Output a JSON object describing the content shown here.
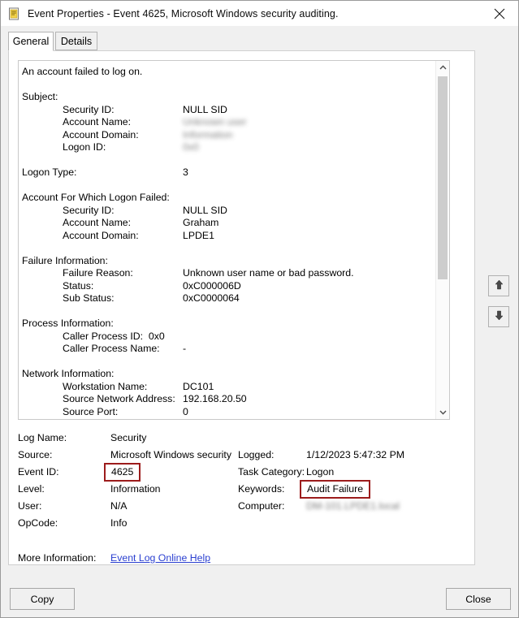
{
  "window": {
    "title": "Event Properties - Event 4625, Microsoft Windows security auditing.",
    "icon": "event-log-icon",
    "close_icon": "close-icon"
  },
  "tabs": [
    {
      "label": "General",
      "active": true
    },
    {
      "label": "Details",
      "active": false
    }
  ],
  "description": {
    "headline": "An account failed to log on.",
    "lines": [
      {
        "indent": 0,
        "label": "Subject:",
        "value": ""
      },
      {
        "indent": 1,
        "label": "Security ID:",
        "value": "NULL SID"
      },
      {
        "indent": 1,
        "label": "Account Name:",
        "value": "Unknown user",
        "blurred": true
      },
      {
        "indent": 1,
        "label": "Account Domain:",
        "value": "Information",
        "blurred": true
      },
      {
        "indent": 1,
        "label": "Logon ID:",
        "value": "0x0",
        "blurred": true
      },
      {
        "indent": 0,
        "label": "",
        "value": ""
      },
      {
        "indent": 0,
        "label": "Logon Type:",
        "value": "3"
      },
      {
        "indent": 0,
        "label": "",
        "value": ""
      },
      {
        "indent": 0,
        "label": "Account For Which Logon Failed:",
        "value": ""
      },
      {
        "indent": 1,
        "label": "Security ID:",
        "value": "NULL SID"
      },
      {
        "indent": 1,
        "label": "Account Name:",
        "value": "Graham"
      },
      {
        "indent": 1,
        "label": "Account Domain:",
        "value": "LPDE1"
      },
      {
        "indent": 0,
        "label": "",
        "value": ""
      },
      {
        "indent": 0,
        "label": "Failure Information:",
        "value": ""
      },
      {
        "indent": 1,
        "label": "Failure Reason:",
        "value": "Unknown user name or bad password."
      },
      {
        "indent": 1,
        "label": "Status:",
        "value": "0xC000006D"
      },
      {
        "indent": 1,
        "label": "Sub Status:",
        "value": "0xC0000064"
      },
      {
        "indent": 0,
        "label": "",
        "value": ""
      },
      {
        "indent": 0,
        "label": "Process Information:",
        "value": ""
      },
      {
        "indent": 1,
        "label": "Caller Process ID:  0x0",
        "value": "",
        "inline": true
      },
      {
        "indent": 1,
        "label": "Caller Process Name:",
        "value": "-"
      },
      {
        "indent": 0,
        "label": "",
        "value": ""
      },
      {
        "indent": 0,
        "label": "Network Information:",
        "value": ""
      },
      {
        "indent": 1,
        "label": "Workstation Name:",
        "value": "DC101"
      },
      {
        "indent": 1,
        "label": "Source Network Address:",
        "value": "192.168.20.50"
      },
      {
        "indent": 1,
        "label": "Source Port:",
        "value": "0"
      }
    ]
  },
  "scrollbar": {
    "up_icon": "chevron-up-icon",
    "down_icon": "chevron-down-icon"
  },
  "metadata": {
    "rows": [
      {
        "label": "Log Name:",
        "value": "Security",
        "label2": "",
        "value2": ""
      },
      {
        "label": "Source:",
        "value": "Microsoft Windows security",
        "label2": "Logged:",
        "value2": "1/12/2023 5:47:32 PM"
      },
      {
        "label": "Event ID:",
        "value": "4625",
        "label2": "Task Category:",
        "value2": "Logon",
        "highlight": true
      },
      {
        "label": "Level:",
        "value": "Information",
        "label2": "Keywords:",
        "value2": "Audit Failure",
        "highlight2": true
      },
      {
        "label": "User:",
        "value": "N/A",
        "label2": "Computer:",
        "value2": "DM-101.LPDE1.local",
        "blurred2": true
      },
      {
        "label": "OpCode:",
        "value": "Info",
        "label2": "",
        "value2": ""
      }
    ],
    "more_label": "More Information:",
    "more_link": "Event Log Online Help"
  },
  "navigation": {
    "up_icon": "arrow-up-icon",
    "down_icon": "arrow-down-icon"
  },
  "footer": {
    "copy_label": "Copy",
    "close_label": "Close"
  },
  "colors": {
    "highlight_box": "#9c1c1c",
    "link": "#2a3fd0",
    "window_bg": "#f0f0f0",
    "panel_bg": "#ffffff"
  }
}
